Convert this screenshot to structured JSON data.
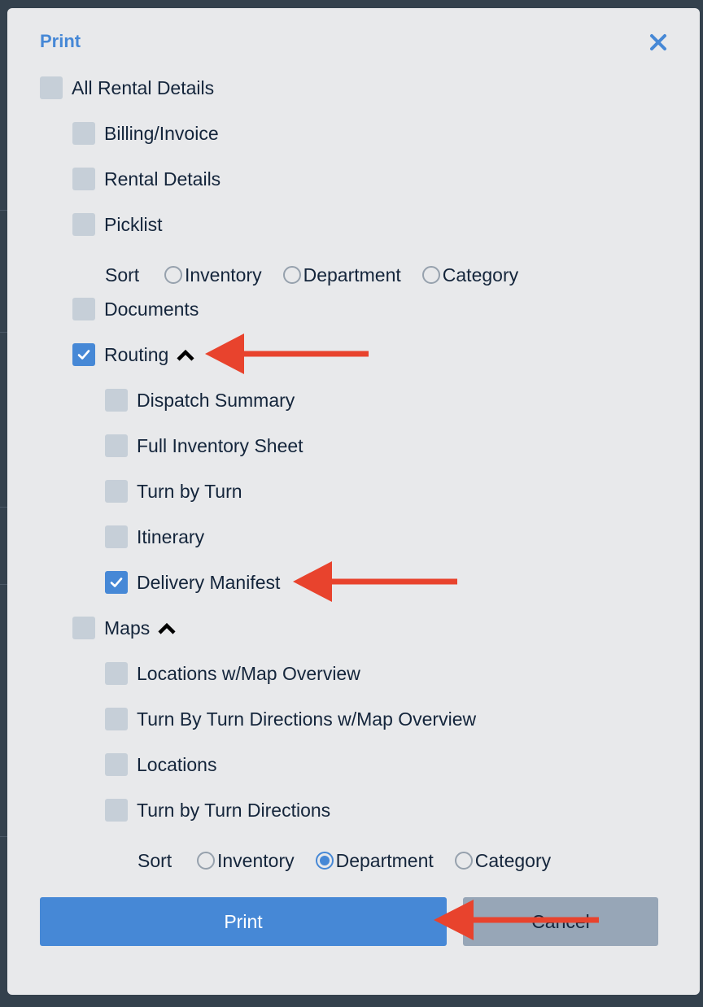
{
  "dialog": {
    "title": "Print",
    "close_icon": "close-icon"
  },
  "options": {
    "all_rental_details": {
      "label": "All Rental Details",
      "checked": false
    },
    "billing_invoice": {
      "label": "Billing/Invoice",
      "checked": false
    },
    "rental_details": {
      "label": "Rental Details",
      "checked": false
    },
    "picklist": {
      "label": "Picklist",
      "checked": false
    },
    "picklist_sort": {
      "label": "Sort",
      "options": [
        "Inventory",
        "Department",
        "Category"
      ],
      "selected": null
    },
    "documents": {
      "label": "Documents",
      "checked": false
    },
    "routing": {
      "label": "Routing",
      "checked": true,
      "expanded": true,
      "children": {
        "dispatch_summary": {
          "label": "Dispatch Summary",
          "checked": false
        },
        "full_inventory_sheet": {
          "label": "Full Inventory Sheet",
          "checked": false
        },
        "turn_by_turn": {
          "label": "Turn by Turn",
          "checked": false
        },
        "itinerary": {
          "label": "Itinerary",
          "checked": false
        },
        "delivery_manifest": {
          "label": "Delivery Manifest",
          "checked": true
        }
      }
    },
    "maps": {
      "label": "Maps",
      "checked": false,
      "expanded": true,
      "children": {
        "locations_map_overview": {
          "label": "Locations w/Map Overview",
          "checked": false
        },
        "turn_by_turn_directions_map_overview": {
          "label": "Turn By Turn Directions w/Map Overview",
          "checked": false
        },
        "locations": {
          "label": "Locations",
          "checked": false
        },
        "turn_by_turn_directions": {
          "label": "Turn by Turn Directions",
          "checked": false
        }
      },
      "sort": {
        "label": "Sort",
        "options": [
          "Inventory",
          "Department",
          "Category"
        ],
        "selected": "Department"
      }
    }
  },
  "buttons": {
    "print_label": "Print",
    "cancel_label": "Cancel"
  },
  "colors": {
    "accent": "#4688d6",
    "modal_bg": "#e8e9eb",
    "checkbox_unchecked": "#c6cfd8",
    "cancel_bg": "#97a6b7",
    "annotation_arrow": "#e8432d"
  }
}
